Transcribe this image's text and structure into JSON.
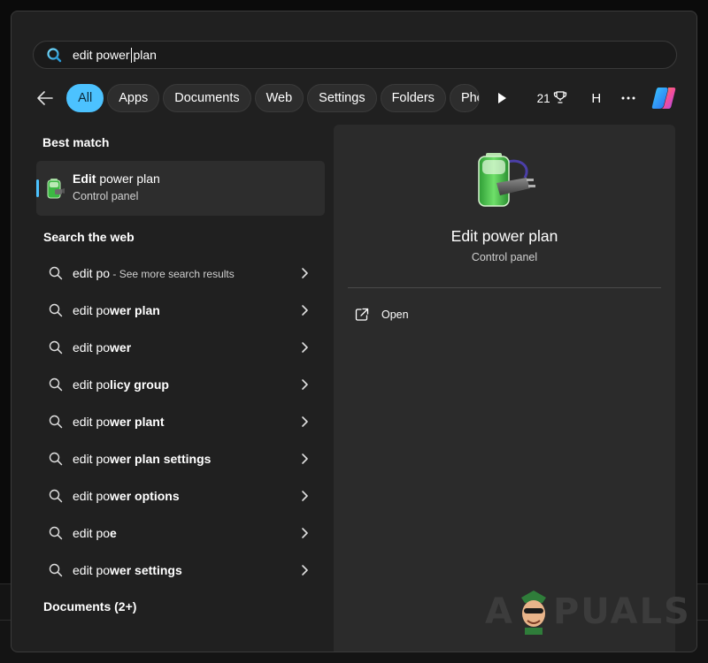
{
  "search": {
    "value": "edit power plan"
  },
  "filters": {
    "chips": [
      "All",
      "Apps",
      "Documents",
      "Web",
      "Settings",
      "Folders"
    ],
    "overflow_chip": "Phot",
    "points": "21",
    "avatar_initial": "H"
  },
  "best_match": {
    "heading": "Best match",
    "title_bold": "Edit",
    "title_rest": " power plan",
    "subtitle": "Control panel"
  },
  "web": {
    "heading": "Search the web",
    "items": [
      {
        "normal": "edit po",
        "bold": "",
        "hint": " - See more search results"
      },
      {
        "normal": "edit po",
        "bold": "wer plan",
        "hint": ""
      },
      {
        "normal": "edit po",
        "bold": "wer",
        "hint": ""
      },
      {
        "normal": "edit po",
        "bold": "licy group",
        "hint": ""
      },
      {
        "normal": "edit po",
        "bold": "wer plant",
        "hint": ""
      },
      {
        "normal": "edit po",
        "bold": "wer plan settings",
        "hint": ""
      },
      {
        "normal": "edit po",
        "bold": "wer options",
        "hint": ""
      },
      {
        "normal": "edit po",
        "bold": "e",
        "hint": ""
      },
      {
        "normal": "edit po",
        "bold": "wer settings",
        "hint": ""
      }
    ]
  },
  "documents": {
    "heading": "Documents (2+)"
  },
  "preview": {
    "title": "Edit power plan",
    "subtitle": "Control panel",
    "action_open": "Open"
  },
  "watermark": {
    "part1": "A",
    "part2": "PUALS"
  },
  "colors": {
    "accent": "#4cc2ff",
    "panel": "#202020",
    "preview": "#2b2b2b"
  }
}
